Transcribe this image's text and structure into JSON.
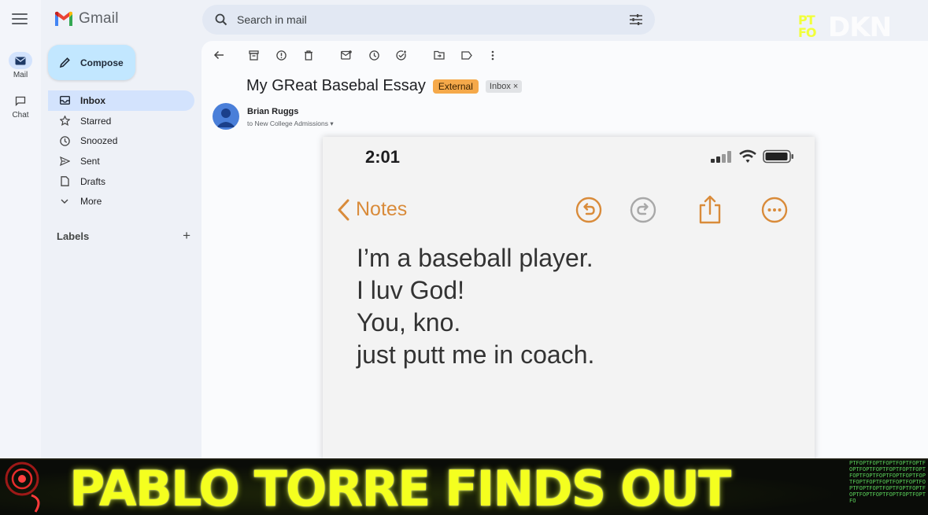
{
  "app": {
    "name": "Gmail"
  },
  "search": {
    "placeholder": "Search in mail"
  },
  "rail": [
    {
      "label": "Mail",
      "icon": "mail-icon",
      "active": true
    },
    {
      "label": "Chat",
      "icon": "chat-icon",
      "active": false
    }
  ],
  "compose": {
    "label": "Compose"
  },
  "nav": [
    {
      "label": "Inbox",
      "icon": "inbox-icon",
      "active": true
    },
    {
      "label": "Starred",
      "icon": "star-icon"
    },
    {
      "label": "Snoozed",
      "icon": "clock-icon"
    },
    {
      "label": "Sent",
      "icon": "send-icon"
    },
    {
      "label": "Drafts",
      "icon": "draft-icon"
    },
    {
      "label": "More",
      "icon": "chevron-down-icon"
    }
  ],
  "labels": {
    "title": "Labels",
    "add": "+"
  },
  "toolbar": [
    "back-arrow-icon",
    "archive-icon",
    "report-spam-icon",
    "delete-icon",
    "mark-unread-icon",
    "snooze-icon",
    "add-task-icon",
    "move-to-icon",
    "label-icon",
    "more-vert-icon"
  ],
  "email": {
    "subject": "My GReat Basebal Essay",
    "badge_external": "External",
    "badge_inbox": "Inbox",
    "badge_inbox_close": "×",
    "sender": "Brian Ruggs",
    "to": "to New College Admissions"
  },
  "phone": {
    "time": "2:01",
    "back_label": "Notes",
    "accent": "#d98b3a",
    "note_lines": [
      "I’m a baseball player.",
      "I luv God!",
      "You, kno.",
      "just putt me in coach."
    ]
  },
  "watermark": {
    "brand": "DKN",
    "tag_top": "PT",
    "tag_bottom": "FO"
  },
  "banner": {
    "title": "PABLO TORRE FINDS OUT",
    "color": "#f4ff1f"
  },
  "colors": {
    "compose_bg": "#c2e7ff",
    "active_nav": "#d3e3fd",
    "external_badge": "#f5a94a"
  }
}
